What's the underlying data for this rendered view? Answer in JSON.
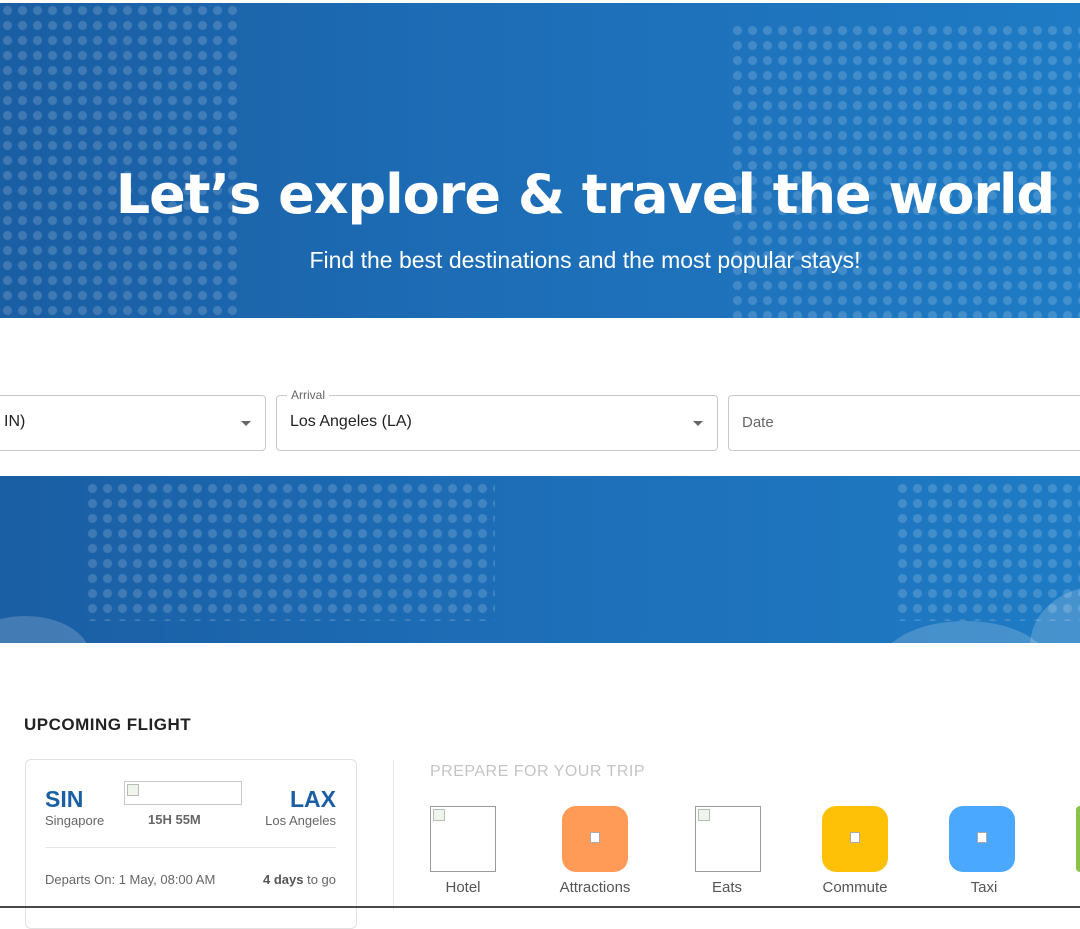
{
  "hero": {
    "title": "Let’s explore & travel the world",
    "subtitle": "Find the best destinations and the most popular stays!"
  },
  "search": {
    "departure_value": "IN)",
    "arrival_legend": "Arrival",
    "arrival_value": "Los Angeles (LA)",
    "date_placeholder": "Date"
  },
  "upcoming": {
    "section_title": "UPCOMING FLIGHT",
    "from_code": "SIN",
    "from_city": "Singapore",
    "to_code": "LAX",
    "to_city": "Los Angeles",
    "duration": "15H 55M",
    "departs": "Departs On: 1 May, 08:00 AM",
    "days_count": "4 days",
    "days_suffix": " to go"
  },
  "prepare": {
    "title": "PREPARE FOR YOUR TRIP",
    "items": [
      {
        "label": "Hotel",
        "icon": "hotel-icon",
        "color": ""
      },
      {
        "label": "Attractions",
        "icon": "attractions-icon",
        "color": "#ff9a57"
      },
      {
        "label": "Eats",
        "icon": "eats-icon",
        "color": ""
      },
      {
        "label": "Commute",
        "icon": "commute-icon",
        "color": "#ffc107"
      },
      {
        "label": "Taxi",
        "icon": "taxi-icon",
        "color": "#4aa8ff"
      }
    ]
  },
  "colors": {
    "brand_blue": "#1a5ea3",
    "hero_blue": "#1e7bc4"
  }
}
